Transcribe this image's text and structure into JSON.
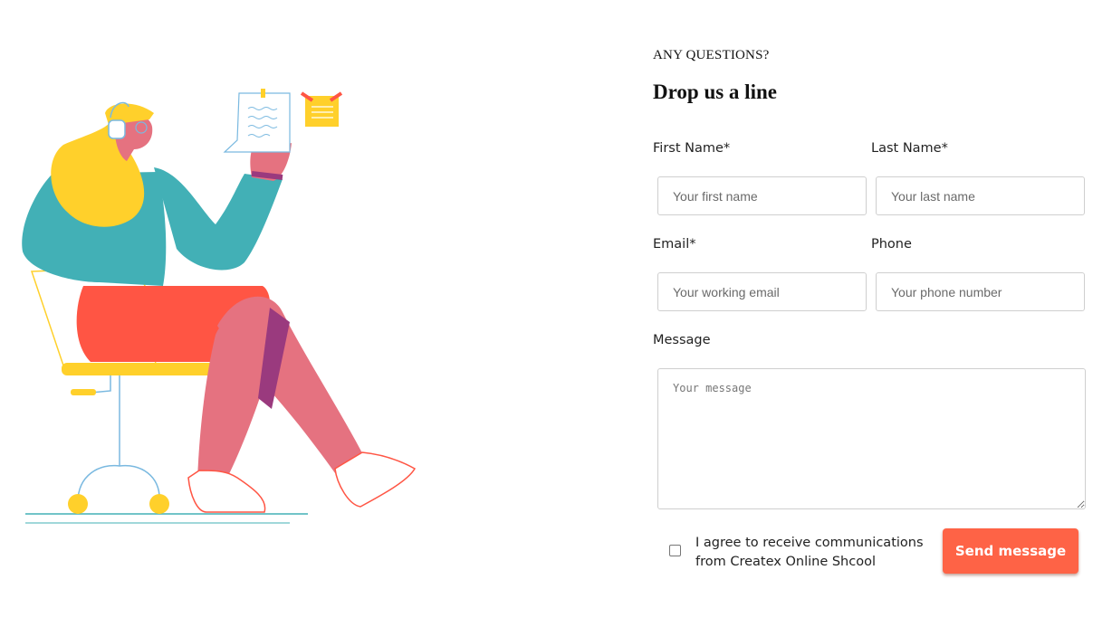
{
  "form": {
    "eyebrow": "ANY QUESTIONS?",
    "heading": "Drop us a line",
    "first_name": {
      "label": "First Name*",
      "placeholder": "Your first name"
    },
    "last_name": {
      "label": "Last Name*",
      "placeholder": "Your last name"
    },
    "email": {
      "label": "Email*",
      "placeholder": "Your working email"
    },
    "phone": {
      "label": "Phone",
      "placeholder": "Your phone number"
    },
    "message": {
      "label": "Message",
      "placeholder": "Your message"
    },
    "consent_text": "I agree to receive communications from Createx Online Shcool",
    "consent_checked": false,
    "submit_label": "Send message"
  },
  "colors": {
    "accent": "#fe6346",
    "illustration_teal": "#42b0b6",
    "illustration_yellow": "#ffd02b",
    "illustration_red": "#ff5544",
    "illustration_pink": "#e57280",
    "illustration_purple": "#9a3a7e",
    "illustration_blue_line": "#7ab9e0"
  },
  "illustration": {
    "icon": "woman-on-chair-with-notes-illustration"
  }
}
